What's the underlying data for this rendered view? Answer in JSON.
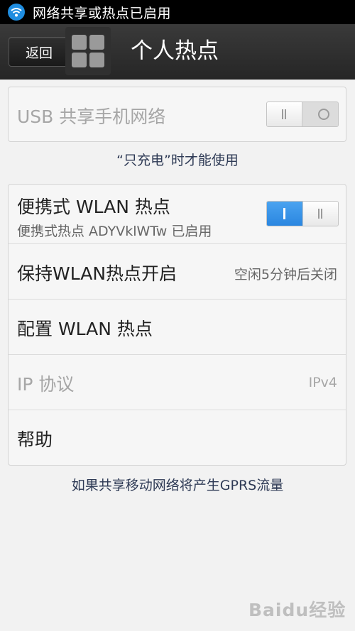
{
  "status_bar": {
    "text": "网络共享或热点已启用",
    "icon": "wifi-hotspot-icon"
  },
  "action_bar": {
    "back_label": "返回",
    "title": "个人热点",
    "app_icon": "grid-apps-icon"
  },
  "usb": {
    "label": "USB 共享手机网络",
    "enabled": false,
    "switch_on": false,
    "note": "“只充电”时才能使用"
  },
  "wlan": {
    "hotspot_label": "便携式 WLAN 热点",
    "hotspot_sub": "便携式热点 ADYVklWTw 已启用",
    "hotspot_on": true,
    "keep_label": "保持WLAN热点开启",
    "keep_value": "空闲5分钟后关闭",
    "config_label": "配置 WLAN 热点",
    "ip_label": "IP 协议",
    "ip_value": "IPv4",
    "help_label": "帮助"
  },
  "footer_note": "如果共享移动网络将产生GPRS流量",
  "watermark": {
    "text": "Baidu经验"
  },
  "colors": {
    "toggle_on": "#2a86e0",
    "disabled_text": "#a6a6a6",
    "note_text": "#2e3a55"
  }
}
